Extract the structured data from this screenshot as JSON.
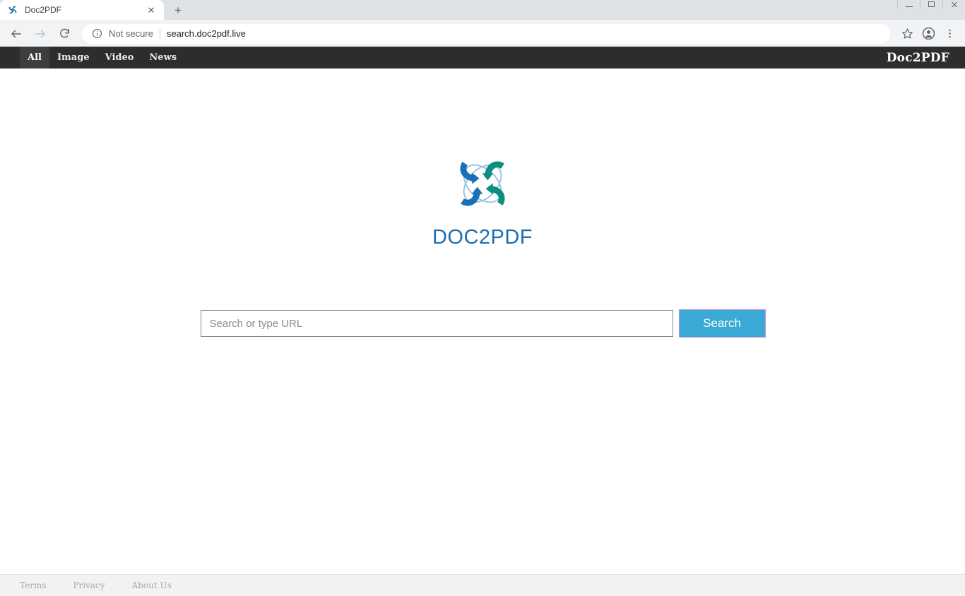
{
  "browser": {
    "window_controls": [
      {
        "name": "minimize",
        "label": "—"
      },
      {
        "name": "maximize",
        "label": "□"
      },
      {
        "name": "close",
        "label": "✕"
      }
    ],
    "tab": {
      "title": "Doc2PDF",
      "favicon": "doc2pdf-pinwheel-favicon",
      "close_label": "✕"
    },
    "new_tab_label": "+",
    "toolbar": {
      "back_label": "←",
      "forward_label": "→",
      "reload_label": "↻",
      "security_label": "Not secure",
      "url": "search.doc2pdf.live",
      "bookmark_icon": "star-icon",
      "profile_icon": "account-avatar-icon",
      "menu_icon": "three-dot-menu-icon"
    }
  },
  "site": {
    "nav": {
      "items": [
        {
          "label": "All",
          "active": true
        },
        {
          "label": "Image",
          "active": false
        },
        {
          "label": "Video",
          "active": false
        },
        {
          "label": "News",
          "active": false
        }
      ],
      "brand": "Doc2PDF",
      "background": "#2d2d2d",
      "active_background": "#3d3d3d"
    },
    "hero": {
      "logo_icon": "doc2pdf-pinwheel-logo",
      "wordmark": "DOC2PDF",
      "wordmark_color": "#1a6eb4",
      "logo_blue": "#1a6fb8",
      "logo_teal": "#0d8f7e"
    },
    "search": {
      "placeholder": "Search or type URL",
      "value": "",
      "button_label": "Search",
      "button_color": "#3aa9d6"
    },
    "footer": {
      "links": [
        {
          "label": "Terms"
        },
        {
          "label": "Privacy"
        },
        {
          "label": "About Us"
        }
      ]
    }
  }
}
